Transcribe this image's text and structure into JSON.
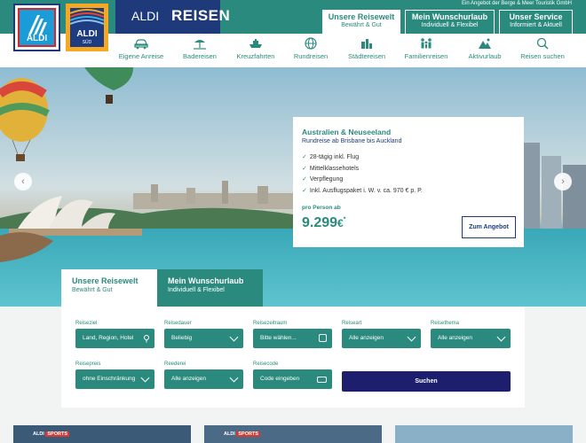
{
  "header": {
    "tagline": "Ein Angebot der Berge & Meer Touristik GmbH",
    "logo1_text": "ALDI",
    "logo2_text": "ALDI",
    "logo2_sub": "SÜD",
    "brand_aldi": "ALDI",
    "brand_reisen": "REISEN",
    "top_tabs": [
      {
        "title": "Unsere Reisewelt",
        "subtitle": "Bewährt & Gut",
        "active": true
      },
      {
        "title": "Mein Wunschurlaub",
        "subtitle": "Individuell & Flexibel",
        "active": false
      },
      {
        "title": "Unser Service",
        "subtitle": "Informiert & Aktuell",
        "active": false
      }
    ]
  },
  "nav": {
    "items": [
      {
        "label": "Eigene Anreise",
        "icon": "car-icon"
      },
      {
        "label": "Badereisen",
        "icon": "beach-umbrella-icon"
      },
      {
        "label": "Kreuzfahrten",
        "icon": "ship-icon"
      },
      {
        "label": "Rundreisen",
        "icon": "globe-icon"
      },
      {
        "label": "Städtereisen",
        "icon": "city-icon"
      },
      {
        "label": "Familienreisen",
        "icon": "family-icon"
      },
      {
        "label": "Aktivurlaub",
        "icon": "mountain-icon"
      },
      {
        "label": "Reisen suchen",
        "icon": "search-icon"
      }
    ]
  },
  "hero": {
    "prev_glyph": "‹",
    "next_glyph": "›",
    "promo": {
      "title": "Australien & Neuseeland",
      "subtitle": "Rundreise ab Brisbane bis Auckland",
      "features": [
        "28-tägig inkl. Flug",
        "Mittelklassehotels",
        "Verpflegung",
        "Inkl. Ausflugspaket i. W. v. ca. 970 € p. P."
      ],
      "price_prefix": "pro Person ab",
      "price": "9.299",
      "price_currency": "€",
      "price_mark": "*",
      "button": "Zum Angebot"
    }
  },
  "search": {
    "tabs": [
      {
        "title": "Unsere Reisewelt",
        "subtitle": "Bewährt & Gut",
        "active": true
      },
      {
        "title": "Mein Wunschurlaub",
        "subtitle": "Individuell & Flexibel",
        "active": false
      }
    ],
    "fields_row1": [
      {
        "label": "Reiseziel",
        "value": "Land, Region, Hotel",
        "icon": "location-icon"
      },
      {
        "label": "Reisedauer",
        "value": "Beliebig",
        "icon": "chevron-down-icon"
      },
      {
        "label": "Reisezeitraum",
        "value": "Bitte wählen...",
        "icon": "calendar-icon"
      },
      {
        "label": "Reiseart",
        "value": "Alle anzeigen",
        "icon": "chevron-down-icon"
      },
      {
        "label": "Reisethema",
        "value": "Alle anzeigen",
        "icon": "chevron-down-icon"
      }
    ],
    "fields_row2": [
      {
        "label": "Reisepreis",
        "value": "ohne Einschränkung",
        "icon": "chevron-down-icon"
      },
      {
        "label": "Reederei",
        "value": "Alle anzeigen",
        "icon": "chevron-down-icon"
      },
      {
        "label": "Reisecode",
        "value": "Code eingeben",
        "icon": "code-icon"
      }
    ],
    "submit": "Suchen"
  },
  "teasers": [
    {
      "brand": "ALDI",
      "tag": "SPORTS"
    },
    {
      "brand": "ALDI",
      "tag": "SPORTS"
    }
  ],
  "colors": {
    "teal": "#2b8a7e",
    "navy": "#1f3a7a",
    "search_button": "#1e1e6e"
  }
}
